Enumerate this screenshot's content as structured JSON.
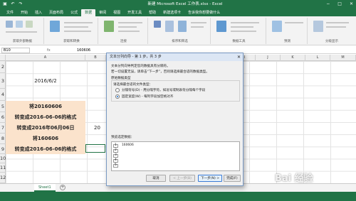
{
  "window": {
    "title": "新建 Microsoft Excel 工作表.xlsx - Excel",
    "qat_icons": [
      "save-icon",
      "undo-icon",
      "redo-icon"
    ],
    "controls": [
      "−",
      "□",
      "✕"
    ]
  },
  "tabs": [
    "文件",
    "开始",
    "插入",
    "页面布局",
    "公式",
    "数据",
    "审阅",
    "视图",
    "开发工具",
    "帮助",
    "新建选项卡",
    "告诉我你想要做什么"
  ],
  "active_tab": "数据",
  "ribbon_groups": [
    "获取外部数据",
    "获取和转换",
    "连接",
    "排序和筛选",
    "数据工具",
    "预测",
    "分级显示"
  ],
  "formula_bar": {
    "name_box": "B10",
    "fx": "fx",
    "value": "160606"
  },
  "columns": [
    "A",
    "B",
    "C",
    "D",
    "E",
    "F",
    "G",
    "H",
    "I",
    "J",
    "K",
    "L",
    "M"
  ],
  "rows": [
    "2",
    "3",
    "4",
    "5",
    "6",
    "7",
    "8",
    "9",
    "10",
    "11",
    "12",
    "13"
  ],
  "cells": {
    "date": "2016/6/2",
    "r5": "将20160606",
    "r6": "转变成2016-06-06的格式",
    "r7": "转变成2016年06月06日",
    "r7c": "20",
    "r9": "将160606",
    "r10": "转变成2016-06-06的格式"
  },
  "sheet_tab": "Sheet1",
  "add_sheet": "+",
  "dialog": {
    "title": "文本分列向导 - 第 1 步，共 3 步",
    "close": "✕",
    "intro1": "文本分列向导判定您的数据具有分隔符。",
    "intro2": "若一切设置无误，请单击“下一步”，否则请选择最合适的数据类型。",
    "section_label": "原始数据类型",
    "choose_label": "请选择最合适的文件类型：",
    "option1": "分隔符号(D)  - 用分隔字符，如逗号或制表符分隔每个字段",
    "option2": "固定宽度(W)  - 每列字段加空格对齐",
    "preview_label": "预览选定数据：",
    "preview_lines": [
      "1",
      "2",
      "3",
      "4",
      "5"
    ],
    "preview_first": "160606",
    "buttons": {
      "cancel": "取消",
      "back": "< 上一步(B)",
      "next": "下一步(N) >",
      "finish": "完成(F)"
    }
  },
  "watermark": "Bai 经验"
}
